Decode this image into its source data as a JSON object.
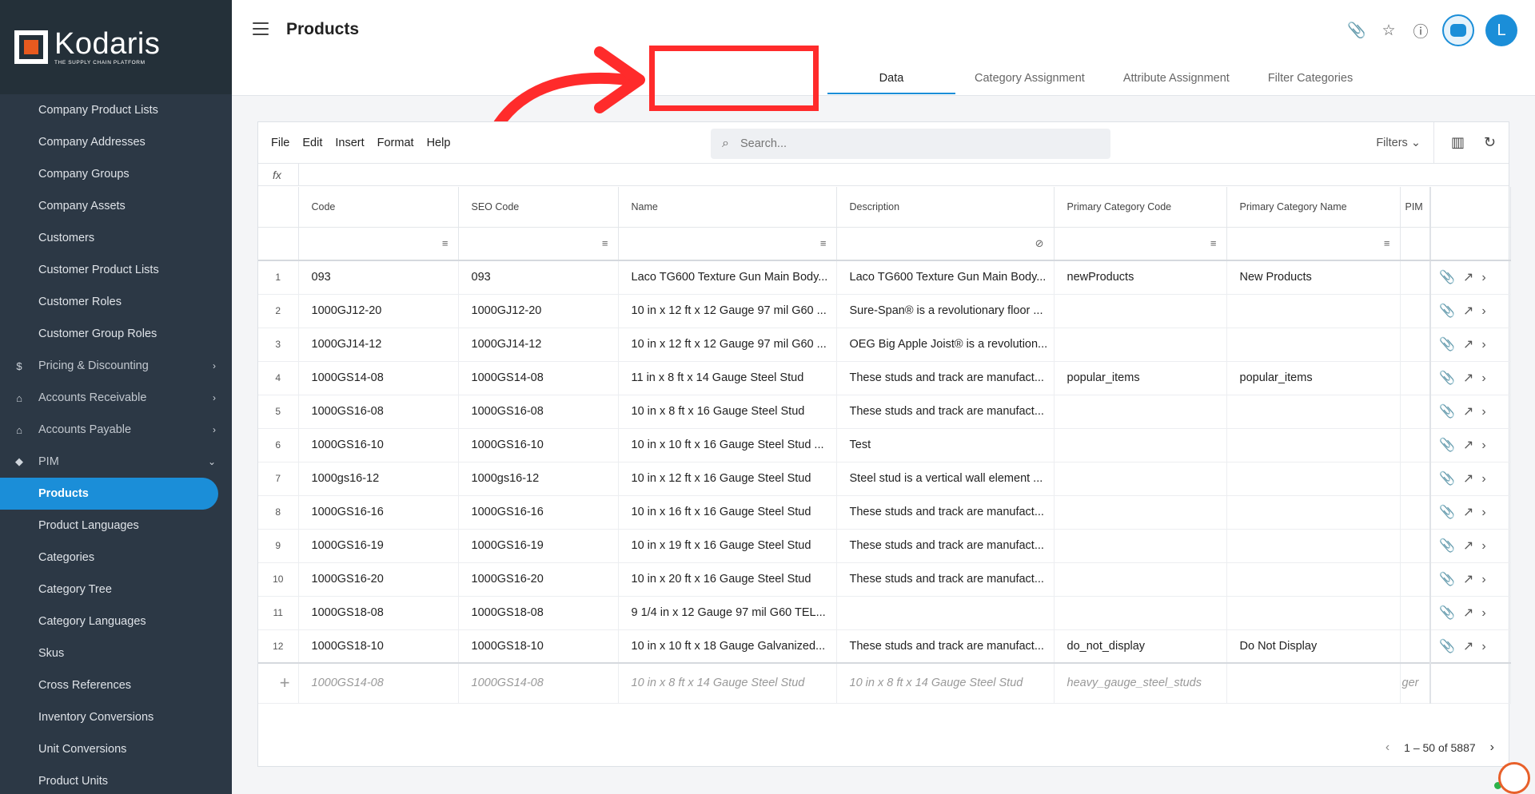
{
  "brand": {
    "name": "Kodaris",
    "tagline": "THE SUPPLY CHAIN PLATFORM"
  },
  "sidebar": {
    "items": [
      {
        "label": "Company Product Lists"
      },
      {
        "label": "Company Addresses"
      },
      {
        "label": "Company Groups"
      },
      {
        "label": "Company Assets"
      },
      {
        "label": "Customers"
      },
      {
        "label": "Customer Product Lists"
      },
      {
        "label": "Customer Roles"
      },
      {
        "label": "Customer Group Roles"
      },
      {
        "label": "Pricing & Discounting",
        "icon": "dollar-icon"
      },
      {
        "label": "Accounts Receivable",
        "icon": "bank-icon"
      },
      {
        "label": "Accounts Payable",
        "icon": "bank-icon"
      },
      {
        "label": "PIM",
        "icon": "tag-icon"
      },
      {
        "label": "Products",
        "active": true
      },
      {
        "label": "Product Languages"
      },
      {
        "label": "Categories"
      },
      {
        "label": "Category Tree"
      },
      {
        "label": "Category Languages"
      },
      {
        "label": "Skus"
      },
      {
        "label": "Cross References"
      },
      {
        "label": "Inventory Conversions"
      },
      {
        "label": "Unit Conversions"
      },
      {
        "label": "Product Units"
      }
    ]
  },
  "header": {
    "title": "Products",
    "avatar_initial": "L"
  },
  "tabs": [
    {
      "label": "Data"
    },
    {
      "label": "Category Assignment"
    },
    {
      "label": "Attribute Assignment"
    },
    {
      "label": "Filter Categories"
    }
  ],
  "toolbar": {
    "menus": [
      "File",
      "Edit",
      "Insert",
      "Format",
      "Help"
    ],
    "search_placeholder": "Search...",
    "filters_label": "Filters"
  },
  "formula_bar": {
    "label": "fx"
  },
  "table": {
    "columns": [
      "Code",
      "SEO Code",
      "Name",
      "Description",
      "Primary Category Code",
      "Primary Category Name",
      "PIM"
    ],
    "rows": [
      {
        "n": "1",
        "code": "093",
        "seo": "093",
        "name": "Laco TG600 Texture Gun Main Body...",
        "desc": "Laco TG600 Texture Gun Main Body...",
        "pcc": "newProducts",
        "pcn": "New Products"
      },
      {
        "n": "2",
        "code": "1000GJ12-20",
        "seo": "1000GJ12-20",
        "name": "10 in x 12 ft x 12 Gauge 97 mil G60 ...",
        "desc": "Sure-Span® is a revolutionary floor ...",
        "pcc": "",
        "pcn": ""
      },
      {
        "n": "3",
        "code": "1000GJ14-12",
        "seo": "1000GJ14-12",
        "name": "10 in x 12 ft x 12 Gauge 97 mil G60 ...",
        "desc": "OEG Big Apple Joist® is a revolution...",
        "pcc": "",
        "pcn": ""
      },
      {
        "n": "4",
        "code": "1000GS14-08",
        "seo": "1000GS14-08",
        "name": "11 in x 8 ft x 14 Gauge Steel Stud",
        "desc": "These studs and track are manufact...",
        "pcc": "popular_items",
        "pcn": "popular_items"
      },
      {
        "n": "5",
        "code": "1000GS16-08",
        "seo": "1000GS16-08",
        "name": "10 in x 8 ft x 16 Gauge Steel Stud",
        "desc": "These studs and track are manufact...",
        "pcc": "",
        "pcn": ""
      },
      {
        "n": "6",
        "code": "1000GS16-10",
        "seo": "1000GS16-10",
        "name": "10 in x 10 ft x 16 Gauge Steel Stud ...",
        "desc": "Test",
        "pcc": "",
        "pcn": ""
      },
      {
        "n": "7",
        "code": "1000gs16-12",
        "seo": "1000gs16-12",
        "name": "10 in x 12 ft x 16 Gauge Steel Stud",
        "desc": "Steel stud is a vertical wall element ...",
        "pcc": "",
        "pcn": ""
      },
      {
        "n": "8",
        "code": "1000GS16-16",
        "seo": "1000GS16-16",
        "name": "10 in x 16 ft x 16 Gauge Steel Stud",
        "desc": "These studs and track are manufact...",
        "pcc": "",
        "pcn": ""
      },
      {
        "n": "9",
        "code": "1000GS16-19",
        "seo": "1000GS16-19",
        "name": "10 in x 19 ft x 16 Gauge Steel Stud",
        "desc": "These studs and track are manufact...",
        "pcc": "",
        "pcn": ""
      },
      {
        "n": "10",
        "code": "1000GS16-20",
        "seo": "1000GS16-20",
        "name": "10 in x 20 ft x 16 Gauge Steel Stud",
        "desc": "These studs and track are manufact...",
        "pcc": "",
        "pcn": ""
      },
      {
        "n": "11",
        "code": "1000GS18-08",
        "seo": "1000GS18-08",
        "name": "9 1/4 in x 12 Gauge 97 mil G60 TEL...",
        "desc": "",
        "pcc": "",
        "pcn": ""
      },
      {
        "n": "12",
        "code": "1000GS18-10",
        "seo": "1000GS18-10",
        "name": "10 in x 10 ft x 18 Gauge Galvanized...",
        "desc": "These studs and track are manufact...",
        "pcc": "do_not_display",
        "pcn": "Do Not Display"
      }
    ],
    "new_row": {
      "code": "1000GS14-08",
      "seo": "1000GS14-08",
      "name": "10 in x 8 ft x 14 Gauge Steel Stud",
      "desc": "10 in x 8 ft x 14 Gauge Steel Stud",
      "pcc": "heavy_gauge_steel_studs",
      "pcn": "",
      "pim": "ger"
    }
  },
  "pagination": {
    "range": "1 – 50 of 5887"
  },
  "colors": {
    "accent": "#1b8ed8",
    "sidebar_bg": "#2c3845",
    "highlight": "#ff2b2b"
  }
}
